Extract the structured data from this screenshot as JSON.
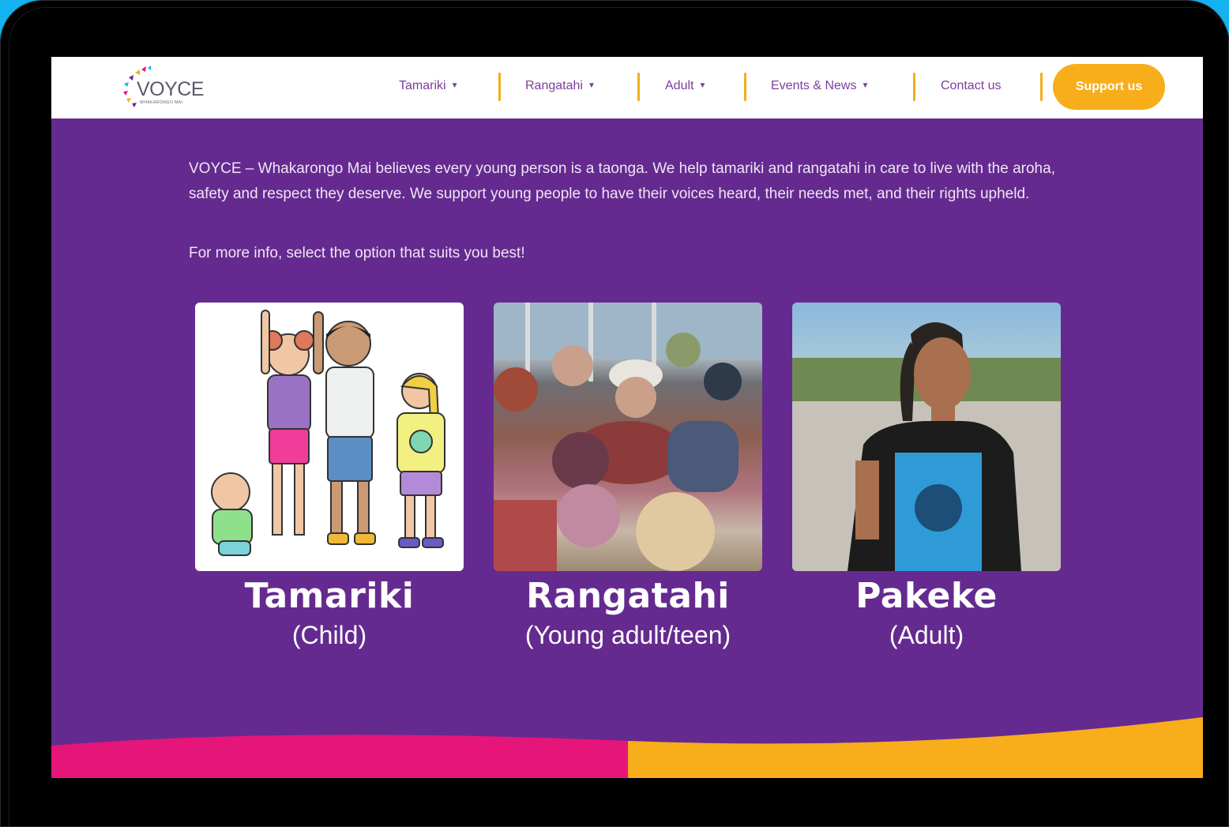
{
  "header": {
    "logo_text": "VOYCE",
    "logo_sub": "WHAKARONGO MAI",
    "nav": [
      {
        "label": "Tamariki",
        "has_dropdown": true
      },
      {
        "label": "Rangatahi",
        "has_dropdown": true
      },
      {
        "label": "Adult",
        "has_dropdown": true
      },
      {
        "label": "Events & News",
        "has_dropdown": true
      },
      {
        "label": "Contact us",
        "has_dropdown": false
      }
    ],
    "support_label": "Support us"
  },
  "intro": {
    "paragraph": "VOYCE – Whakarongo Mai believes every young person is a taonga. We help tamariki and rangatahi in care to live with the aroha, safety and respect they deserve. We support young people to have their voices heard, their needs met, and their rights upheld.",
    "prompt": "For more info, select the option that suits you best!"
  },
  "cards": [
    {
      "title": "Tamariki",
      "subtitle": "(Child)",
      "image": "illustration-children"
    },
    {
      "title": "Rangatahi",
      "subtitle": "(Young adult/teen)",
      "image": "photo-group-teens"
    },
    {
      "title": "Pakeke",
      "subtitle": "(Adult)",
      "image": "photo-adult-man"
    }
  ],
  "colors": {
    "background": "#12b3f0",
    "page": "#652a8f",
    "accent": "#f8ad1a",
    "nav_text": "#7b3e9c",
    "pink": "#e6157a"
  }
}
